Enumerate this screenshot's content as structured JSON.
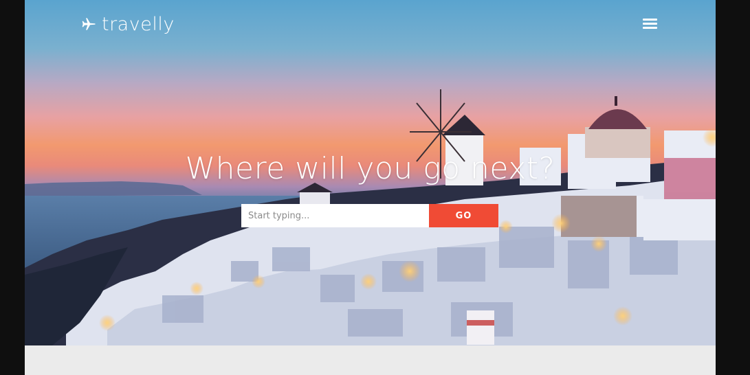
{
  "brand": {
    "name": "travelly",
    "icon": "plane-icon"
  },
  "nav": {
    "menu_icon": "hamburger-menu-icon"
  },
  "hero": {
    "headline": "Where will you go next?",
    "background": "santorini-sunset-photo"
  },
  "search": {
    "placeholder": "Start typing...",
    "value": "",
    "button_label": "GO"
  },
  "colors": {
    "accent": "#f04b35",
    "page_bg": "#ebebeb",
    "outer_bg": "#0f0f0f"
  }
}
